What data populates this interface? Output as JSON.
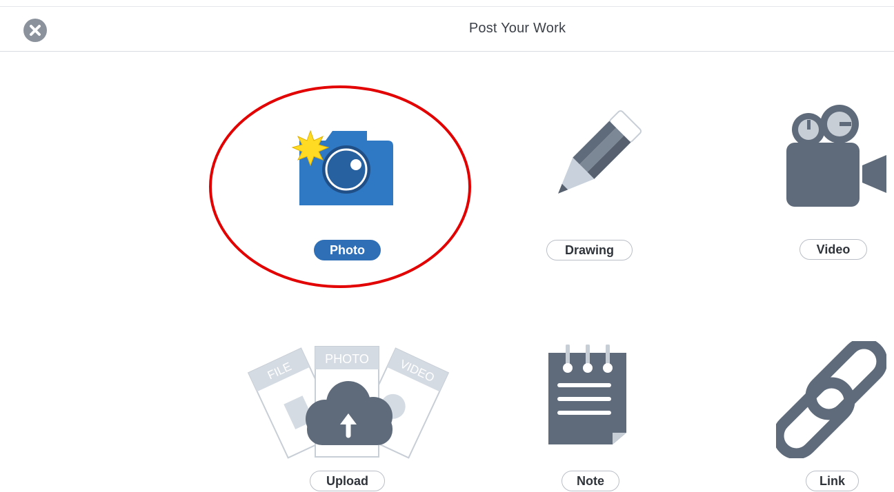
{
  "header": {
    "title": "Post Your Work"
  },
  "icons": {
    "close": "close-icon",
    "photo": "camera-icon",
    "drawing": "pencil-icon",
    "video": "video-camera-icon",
    "upload": "cloud-upload-icon",
    "note": "notepad-icon",
    "link": "chain-link-icon"
  },
  "options": {
    "photo": {
      "label": "Photo",
      "selected": true
    },
    "drawing": {
      "label": "Drawing",
      "selected": false
    },
    "video": {
      "label": "Video",
      "selected": false
    },
    "upload": {
      "label": "Upload",
      "selected": false,
      "card_labels": {
        "file": "FILE",
        "photo": "PHOTO",
        "video": "VIDEO"
      }
    },
    "note": {
      "label": "Note",
      "selected": false
    },
    "link": {
      "label": "Link",
      "selected": false
    }
  },
  "colors": {
    "accent": "#2f6fb5",
    "annotation": "#e30000",
    "icon_gray": "#5f6b7a"
  }
}
